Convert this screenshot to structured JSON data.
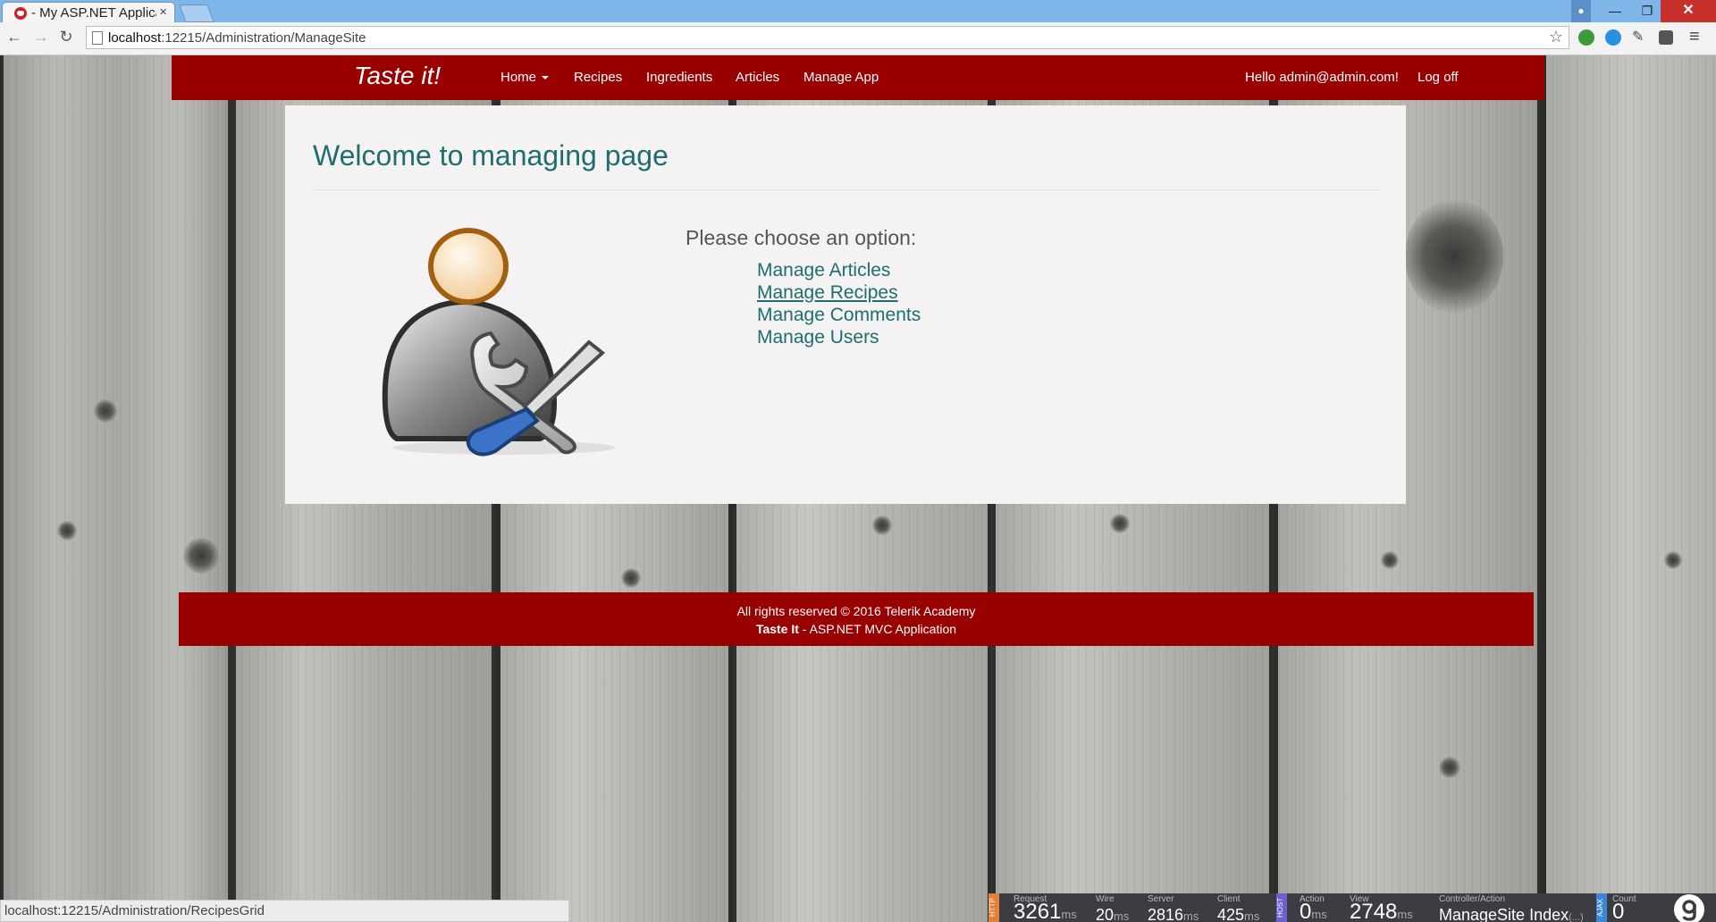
{
  "browser": {
    "tab_title": "- My ASP.NET Applica",
    "tab_close": "×",
    "url_host": "localhost",
    "url_path": ":12215/Administration/ManageSite",
    "win_min": "—",
    "win_max": "❐",
    "win_close": "✕",
    "back": "←",
    "forward": "→",
    "reload": "↻",
    "star": "☆",
    "menu": "≡",
    "status_url": "localhost:12215/Administration/RecipesGrid",
    "icons": [
      "tab-favicon-icon",
      "page-icon",
      "bookmark-star-icon",
      "extension-icon",
      "chrome-menu-icon"
    ]
  },
  "site": {
    "brand": "Taste it!",
    "nav": {
      "home": "Home",
      "recipes": "Recipes",
      "ingredients": "Ingredients",
      "articles": "Articles",
      "manage": "Manage App",
      "hello": "Hello admin@admin.com!",
      "logoff": "Log off"
    },
    "title": "Welcome to managing page",
    "choose": "Please choose an option:",
    "options": [
      "Manage Articles",
      "Manage Recipes",
      "Manage Comments",
      "Manage Users"
    ],
    "footer": {
      "line1": "All rights reserved © 2016 Telerik Academy",
      "brand": "Taste It",
      "line2_rest": " - ASP.NET MVC Application"
    },
    "colors": {
      "brand_red": "#990000",
      "link_teal": "#1f6e6e",
      "panel_bg": "#f4f2f2"
    }
  },
  "hud": {
    "http_tag": "HTTP",
    "host_tag": "HOST",
    "ajax_tag": "AJAX",
    "request": {
      "label": "Request",
      "value": "3261",
      "unit": "ms"
    },
    "wire": {
      "label": "Wire",
      "value": "20",
      "unit": "ms"
    },
    "server": {
      "label": "Server",
      "value": "2816",
      "unit": "ms"
    },
    "client": {
      "label": "Client",
      "value": "425",
      "unit": "ms"
    },
    "action": {
      "label": "Action",
      "value": "0",
      "unit": "ms"
    },
    "view": {
      "label": "View",
      "value": "2748",
      "unit": "ms"
    },
    "controller": {
      "label": "Controller/Action",
      "value": "ManageSite Index",
      "sub": "(...)"
    },
    "count": {
      "label": "Count",
      "value": "0"
    }
  }
}
